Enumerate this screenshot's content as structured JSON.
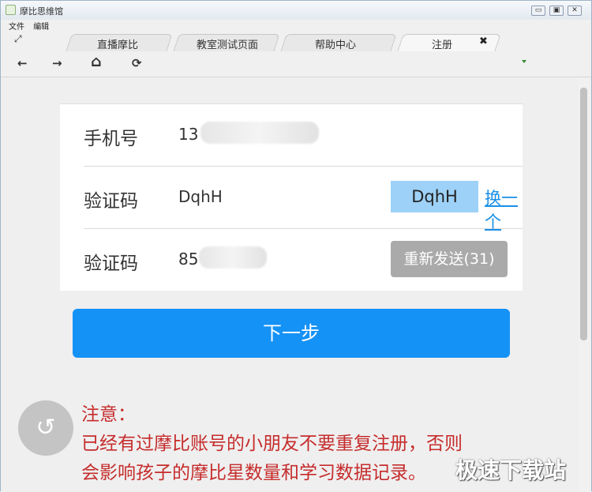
{
  "window": {
    "title": "摩比思维馆",
    "menu": [
      "文件",
      "编辑"
    ],
    "controls": {
      "minimize": "▭",
      "restore": "▣",
      "close": "✕"
    }
  },
  "tabs": [
    {
      "label": "直播摩比",
      "active": false
    },
    {
      "label": "教室测试页面",
      "active": false
    },
    {
      "label": "帮助中心",
      "active": false
    },
    {
      "label": "注册",
      "active": true
    }
  ],
  "tab_close_icon": "✖",
  "nav": {
    "back_icon": "←",
    "forward_icon": "→",
    "home_icon": "⌂",
    "refresh_icon": "⟳"
  },
  "form": {
    "phone_label": "手机号",
    "phone_value": "13",
    "captcha_label": "验证码",
    "captcha_value": "DqhH",
    "captcha_image_text": "DqhH",
    "captcha_refresh": "换一个",
    "sms_label": "验证码",
    "sms_value": "85",
    "resend_button": "重新发送(31)"
  },
  "next_button": "下一步",
  "notice": {
    "title": "注意：",
    "line1": "已经有过摩比账号的小朋友不要重复注册，否则",
    "line2": "会影响孩子的摩比星数量和学习数据记录。"
  },
  "back_icon": "↺",
  "watermark": "极速下载站",
  "colors": {
    "primary": "#1592f6",
    "notice": "#c62c2c",
    "captcha_bg": "#9dd1f7"
  }
}
